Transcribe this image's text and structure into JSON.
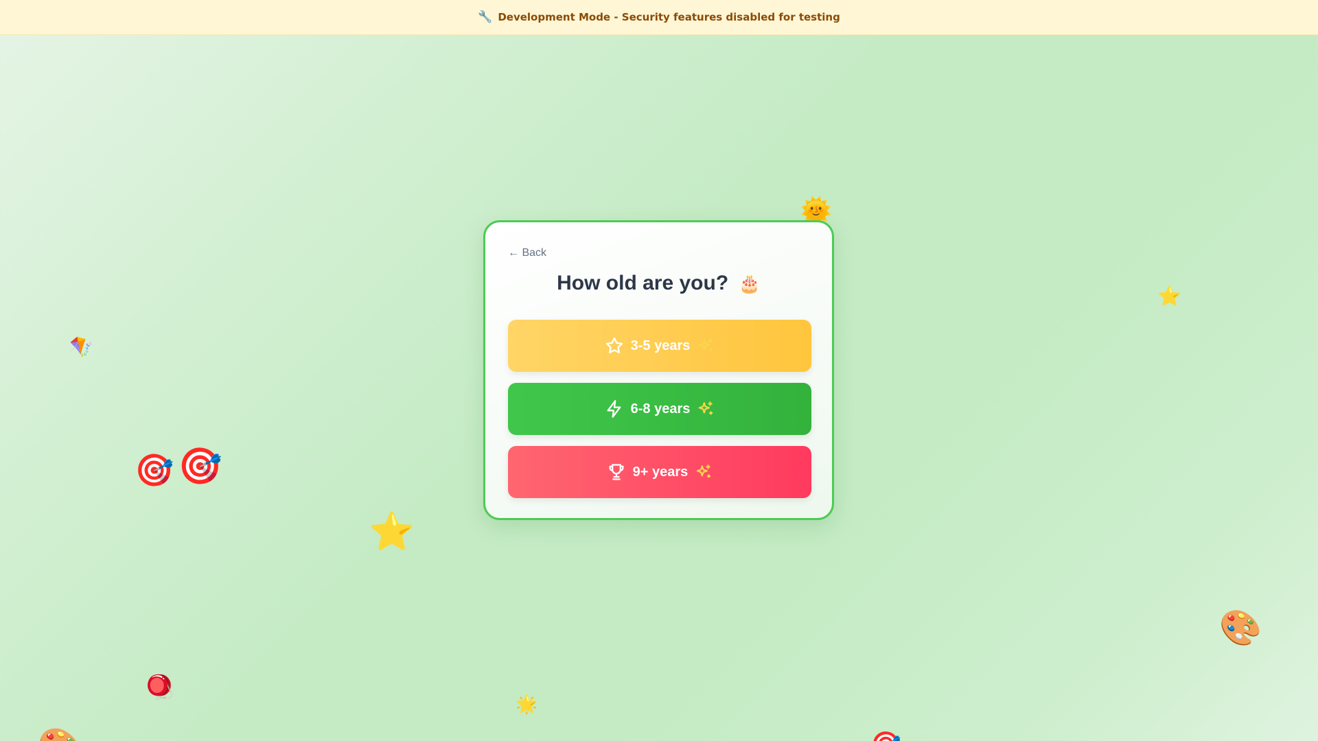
{
  "banner": {
    "icon": "wrench-icon",
    "text": "Development Mode - Security features disabled for testing"
  },
  "card": {
    "back_label": "← Back",
    "title": "How old are you?",
    "title_emoji": "🎂",
    "options": [
      {
        "label": "3-5 years",
        "icon": "star-outline-icon",
        "color_from": "#ffd566",
        "color_to": "#ffc53d"
      },
      {
        "label": "6-8 years",
        "icon": "lightning-icon",
        "color_from": "#40c74a",
        "color_to": "#33b23c"
      },
      {
        "label": "9+ years",
        "icon": "trophy-icon",
        "color_from": "#ff6670",
        "color_to": "#ff3a5f"
      }
    ],
    "border_color": "#4ccb55",
    "sparkle_color": "#f9d74a"
  },
  "decorations": {
    "sun": "🌞",
    "star": "⭐",
    "kite": "🪁",
    "target": "🎯",
    "palette": "🎨",
    "yoyo": "🪀",
    "sparkle": "🌟"
  }
}
